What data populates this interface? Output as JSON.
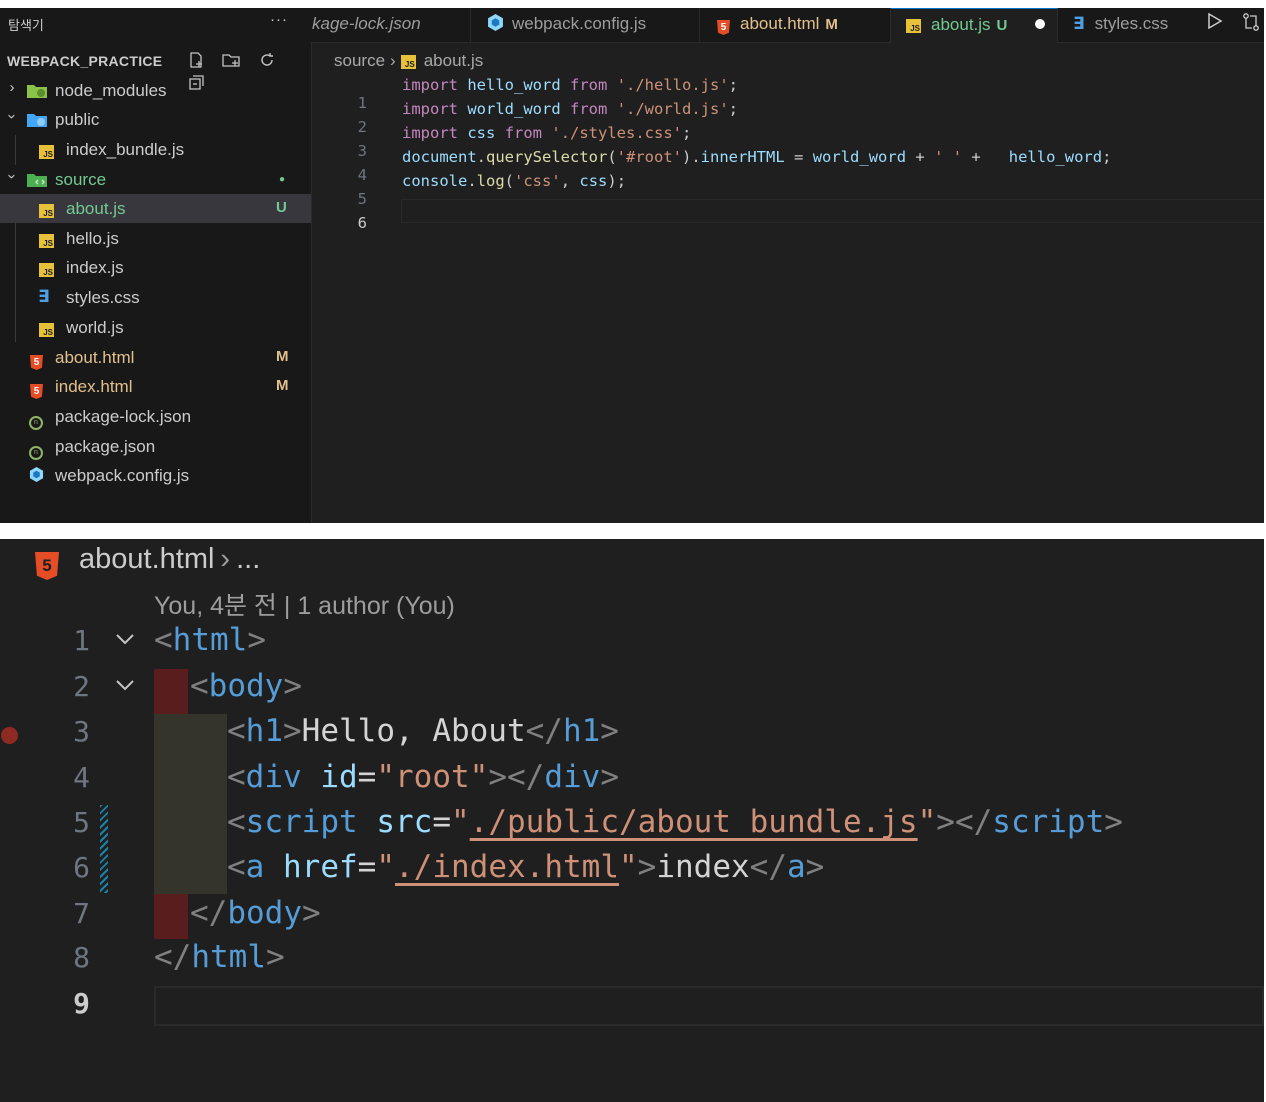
{
  "explorer": {
    "title": "탐색기",
    "more": "···",
    "project": "WEBPACK_PRACTICE",
    "items": [
      {
        "label": "node_modules",
        "status": ""
      },
      {
        "label": "public",
        "status": ""
      },
      {
        "label": "index_bundle.js",
        "status": ""
      },
      {
        "label": "source",
        "status": "●"
      },
      {
        "label": "about.js",
        "status": "U"
      },
      {
        "label": "hello.js",
        "status": ""
      },
      {
        "label": "index.js",
        "status": ""
      },
      {
        "label": "styles.css",
        "status": ""
      },
      {
        "label": "world.js",
        "status": ""
      },
      {
        "label": "about.html",
        "status": "M"
      },
      {
        "label": "index.html",
        "status": "M"
      },
      {
        "label": "package-lock.json",
        "status": ""
      },
      {
        "label": "package.json",
        "status": ""
      },
      {
        "label": "webpack.config.js",
        "status": ""
      }
    ]
  },
  "tabs": [
    {
      "label": "kage-lock.json",
      "badge": ""
    },
    {
      "label": "webpack.config.js",
      "badge": ""
    },
    {
      "label": "about.html",
      "badge": "M"
    },
    {
      "label": "about.js",
      "badge": "U"
    },
    {
      "label": "styles.css",
      "badge": ""
    }
  ],
  "editor_top": {
    "breadcrumb": [
      "source",
      "about.js"
    ],
    "line_numbers": [
      "1",
      "2",
      "3",
      "4",
      "5",
      "6"
    ]
  },
  "editor_bottom": {
    "breadcrumb_file": "about.html",
    "breadcrumb_more": "...",
    "blame": "You, 4분 전 | 1 author (You)",
    "line_numbers": [
      "1",
      "2",
      "3",
      "4",
      "5",
      "6",
      "7",
      "8",
      "9"
    ]
  },
  "colors": {
    "accent": "#0078d4",
    "modified": "#e2c08d",
    "untracked": "#73c991"
  }
}
